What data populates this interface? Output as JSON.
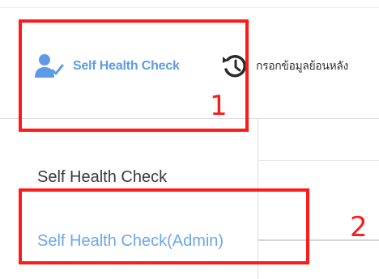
{
  "toolbar": {
    "self_health_check": {
      "label": "Self Health Check",
      "icon": "user-check-icon"
    },
    "history_entry": {
      "label": "กรอกข้อมูลย้อนหลัง",
      "icon": "history-icon"
    }
  },
  "menu": {
    "items": [
      {
        "label": "Self Health Check"
      },
      {
        "label": "Self Health Check(Admin)"
      }
    ]
  },
  "annotations": [
    {
      "number": "1",
      "color": "#ff1a1a"
    },
    {
      "number": "2",
      "color": "#ff1a1a"
    }
  ],
  "colors": {
    "accent": "#5e9be4",
    "highlight": "#ff1a1a"
  }
}
